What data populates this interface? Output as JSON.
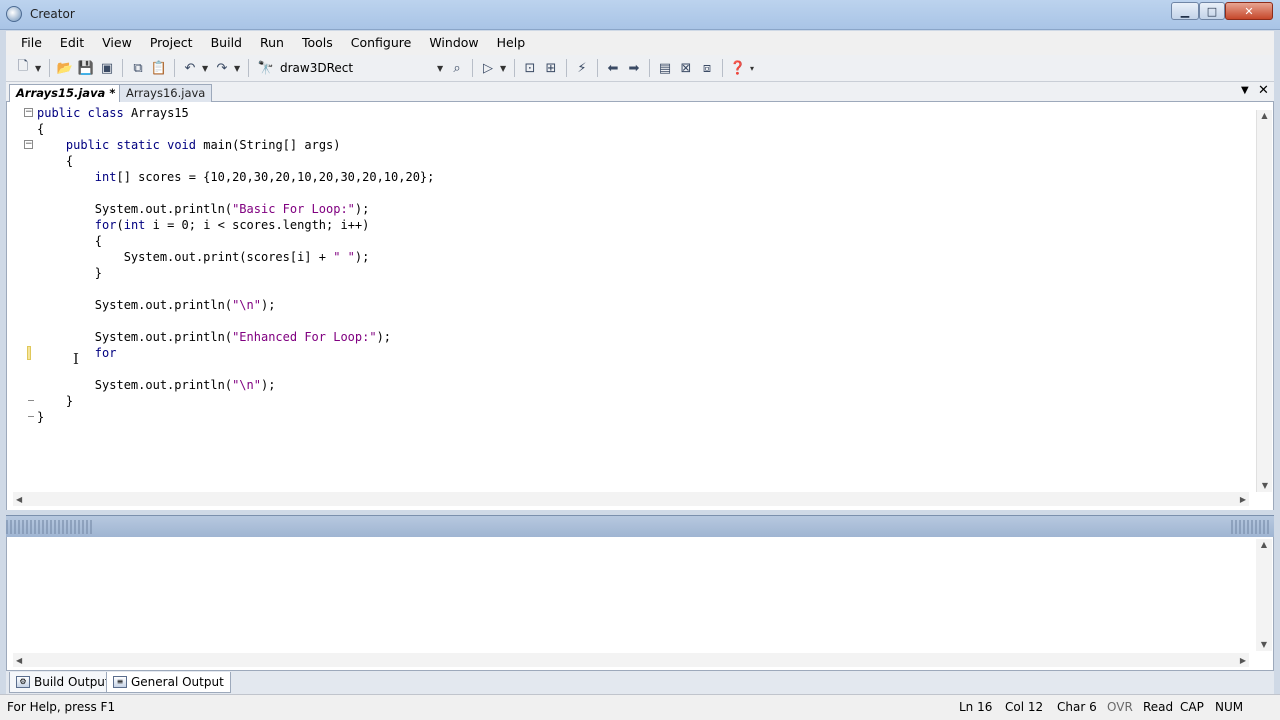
{
  "window": {
    "title": "Creator"
  },
  "menu": [
    "File",
    "Edit",
    "View",
    "Project",
    "Build",
    "Run",
    "Tools",
    "Configure",
    "Window",
    "Help"
  ],
  "toolbar": {
    "target": "draw3DRect",
    "icons": [
      "new-file-icon",
      "open-folder-icon",
      "save-icon",
      "save-all-icon",
      "copy-icon",
      "paste-icon",
      "undo-icon",
      "redo-icon",
      "binoculars-icon"
    ]
  },
  "tabs": {
    "active": "Arrays15.java *",
    "other": "Arrays16.java"
  },
  "code_lines": [
    "public class Arrays15",
    "{",
    "    public static void main(String[] args)",
    "    {",
    "        int[] scores = {10,20,30,20,10,20,30,20,10,20};",
    "",
    "        System.out.println(\"Basic For Loop:\");",
    "        for(int i = 0; i < scores.length; i++)",
    "        {",
    "            System.out.print(scores[i] + \" \");",
    "        }",
    "",
    "        System.out.println(\"\\n\");",
    "",
    "        System.out.println(\"Enhanced For Loop:\");",
    "        for",
    "",
    "        System.out.println(\"\\n\");",
    "    }",
    "}"
  ],
  "output_tabs": {
    "build": "Build Output",
    "general": "General Output"
  },
  "status": {
    "help": "For Help, press F1",
    "ln": "Ln 16",
    "col": "Col 12",
    "char": "Char 6",
    "ovr": "OVR",
    "read": "Read",
    "cap": "CAP",
    "num": "NUM"
  },
  "colors": {
    "keyword": "#000080",
    "string": "#800080",
    "accent": "#a9c4e6"
  }
}
